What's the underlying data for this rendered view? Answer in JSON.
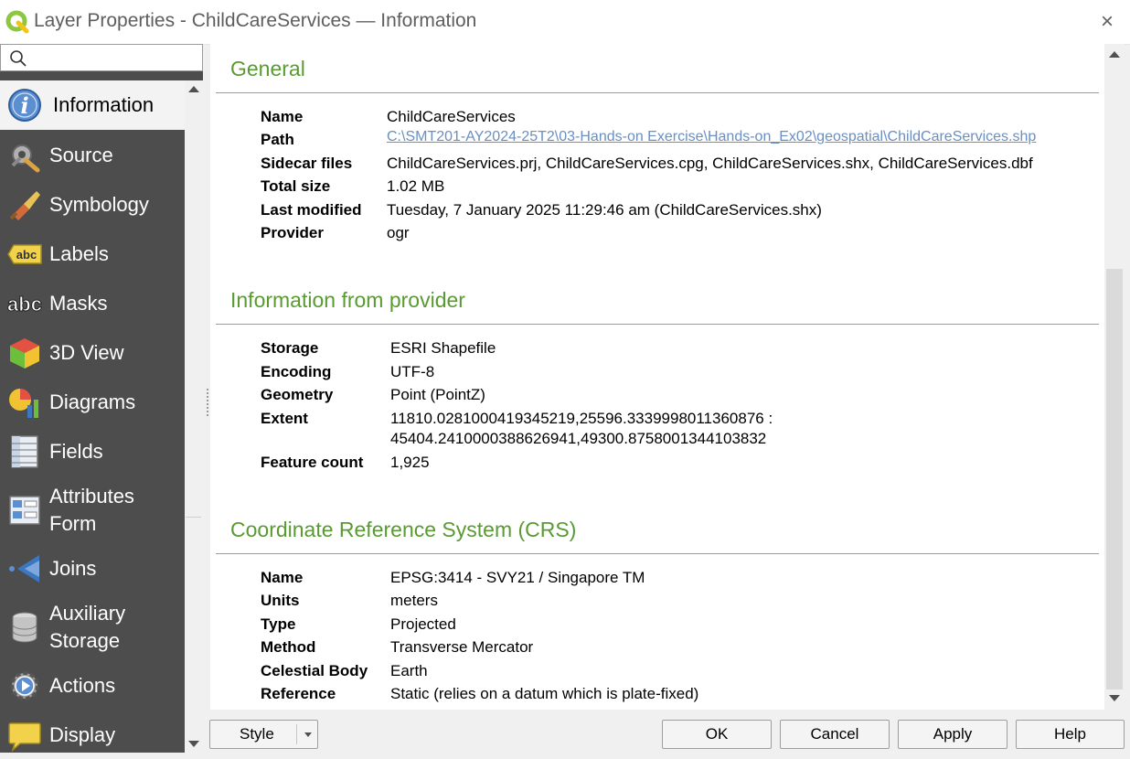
{
  "window": {
    "title": "Layer Properties - ChildCareServices — Information",
    "close_icon": "×"
  },
  "search": {
    "placeholder": "",
    "value": ""
  },
  "sidebar": {
    "items": [
      {
        "label": "Information",
        "icon": "information-icon"
      },
      {
        "label": "Source",
        "icon": "source-icon"
      },
      {
        "label": "Symbology",
        "icon": "symbology-icon"
      },
      {
        "label": "Labels",
        "icon": "labels-icon"
      },
      {
        "label": "Masks",
        "icon": "masks-icon"
      },
      {
        "label": "3D View",
        "icon": "3d-view-icon"
      },
      {
        "label": "Diagrams",
        "icon": "diagrams-icon"
      },
      {
        "label": "Fields",
        "icon": "fields-icon"
      },
      {
        "label": "Attributes\nForm",
        "label_line1": "Attributes",
        "label_line2": "Form",
        "icon": "attributes-form-icon"
      },
      {
        "label": "Joins",
        "icon": "joins-icon"
      },
      {
        "label": "Auxiliary\nStorage",
        "label_line1": "Auxiliary",
        "label_line2": "Storage",
        "icon": "auxiliary-storage-icon"
      },
      {
        "label": "Actions",
        "icon": "actions-icon"
      },
      {
        "label": "Display",
        "icon": "display-icon"
      }
    ],
    "abc_text": "abc"
  },
  "general": {
    "title": "General",
    "rows": [
      {
        "key": "Name",
        "value": "ChildCareServices"
      },
      {
        "key": "Path",
        "value": "C:\\SMT201-AY2024-25T2\\03-Hands-on Exercise\\Hands-on_Ex02\\geospatial\\ChildCareServices.shp"
      },
      {
        "key": "Sidecar files",
        "value": "ChildCareServices.prj, ChildCareServices.cpg, ChildCareServices.shx, ChildCareServices.dbf"
      },
      {
        "key": "Total size",
        "value": "1.02 MB"
      },
      {
        "key": "Last modified",
        "value": "Tuesday, 7 January 2025 11:29:46 am (ChildCareServices.shx)"
      },
      {
        "key": "Provider",
        "value": "ogr"
      }
    ]
  },
  "provider": {
    "title": "Information from provider",
    "rows": [
      {
        "key": "Storage",
        "value": "ESRI Shapefile"
      },
      {
        "key": "Encoding",
        "value": "UTF-8"
      },
      {
        "key": "Geometry",
        "value": "Point (PointZ)"
      },
      {
        "key": "Extent",
        "value": "11810.0281000419345219,25596.3339998011360876 :",
        "value2": "45404.2410000388626941,49300.8758001344103832"
      },
      {
        "key": "Feature count",
        "value": "1,925"
      }
    ]
  },
  "crs": {
    "title": "Coordinate Reference System (CRS)",
    "rows": [
      {
        "key": "Name",
        "value": "EPSG:3414 - SVY21 / Singapore TM"
      },
      {
        "key": "Units",
        "value": "meters"
      },
      {
        "key": "Type",
        "value": "Projected"
      },
      {
        "key": "Method",
        "value": "Transverse Mercator"
      },
      {
        "key": "Celestial Body",
        "value": "Earth"
      },
      {
        "key": "Reference",
        "value": "Static (relies on a datum which is plate-fixed)"
      }
    ]
  },
  "buttons": {
    "style": "Style",
    "ok": "OK",
    "cancel": "Cancel",
    "apply": "Apply",
    "help": "Help"
  },
  "colors": {
    "section_title": "#5a9a32",
    "sidebar_bg": "#4d4d4d",
    "link": "#6a8fc0"
  }
}
